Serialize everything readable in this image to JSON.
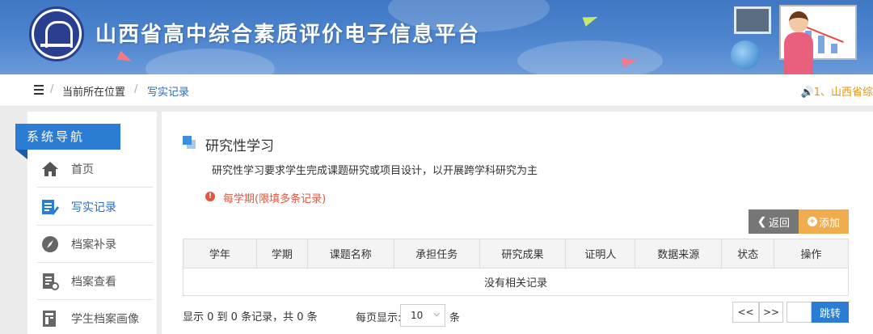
{
  "header": {
    "site_title": "山西省高中综合素质评价电子信息平台"
  },
  "breadcrumb": {
    "separator": "/",
    "location_label": "当前所在位置",
    "current": "写实记录"
  },
  "notice": "🔊1、山西省综",
  "sidebar": {
    "title": "系统导航",
    "items": [
      {
        "label": "首页",
        "icon": "home-icon"
      },
      {
        "label": "写实记录",
        "icon": "edit-note-icon",
        "active": true
      },
      {
        "label": "档案补录",
        "icon": "compass-icon"
      },
      {
        "label": "档案查看",
        "icon": "document-view-icon"
      },
      {
        "label": "学生档案画像",
        "icon": "profile-icon"
      }
    ]
  },
  "main": {
    "section_title": "研究性学习",
    "description": "研究性学习要求学生完成课题研究或项目设计，以开展跨学科研究为主",
    "warning": "每学期(限填多条记录)",
    "back_button": "返回",
    "add_button": "添加",
    "table": {
      "headers": [
        "学年",
        "学期",
        "课题名称",
        "承担任务",
        "研究成果",
        "证明人",
        "数据来源",
        "状态",
        "操作"
      ],
      "empty_text": "没有相关记录"
    },
    "pagination": {
      "info": "显示 0 到 0 条记录，共 0 条",
      "per_page_label": "每页显示:",
      "per_page_value": "10",
      "per_page_unit": "条",
      "prev": "<<",
      "next": ">>",
      "jump": "跳转"
    }
  },
  "colors": {
    "primary": "#2b7dd3",
    "banner": "#4f86cf",
    "warning": "#e2553f",
    "add": "#f0ad4e",
    "back": "#777777",
    "notice": "#e8920e"
  }
}
